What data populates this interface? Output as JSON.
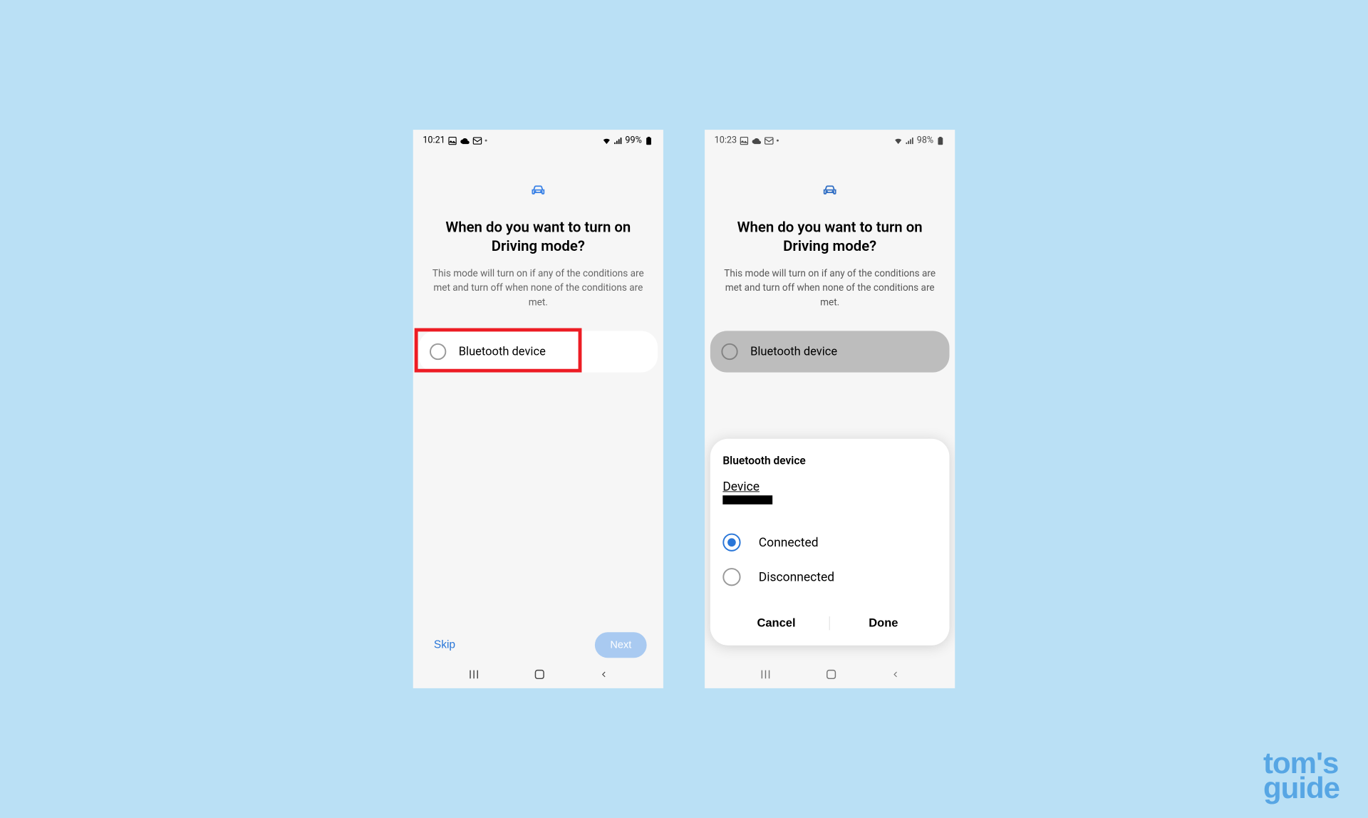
{
  "screen1": {
    "status": {
      "time": "10:21",
      "battery": "99%"
    },
    "heading": "When do you want to turn on Driving mode?",
    "subtext": "This mode will turn on if any of the conditions are met and turn off when none of the conditions are met.",
    "option_label": "Bluetooth device",
    "skip": "Skip",
    "next": "Next"
  },
  "screen2": {
    "status": {
      "time": "10:23",
      "battery": "98%"
    },
    "heading": "When do you want to turn on Driving mode?",
    "subtext": "This mode will turn on if any of the conditions are met and turn off when none of the conditions are met.",
    "option_label": "Bluetooth device",
    "dialog": {
      "title": "Bluetooth device",
      "device_label": "Device",
      "option_connected": "Connected",
      "option_disconnected": "Disconnected",
      "cancel": "Cancel",
      "done": "Done"
    }
  },
  "watermark": {
    "line1": "tom's",
    "line2": "guide"
  }
}
